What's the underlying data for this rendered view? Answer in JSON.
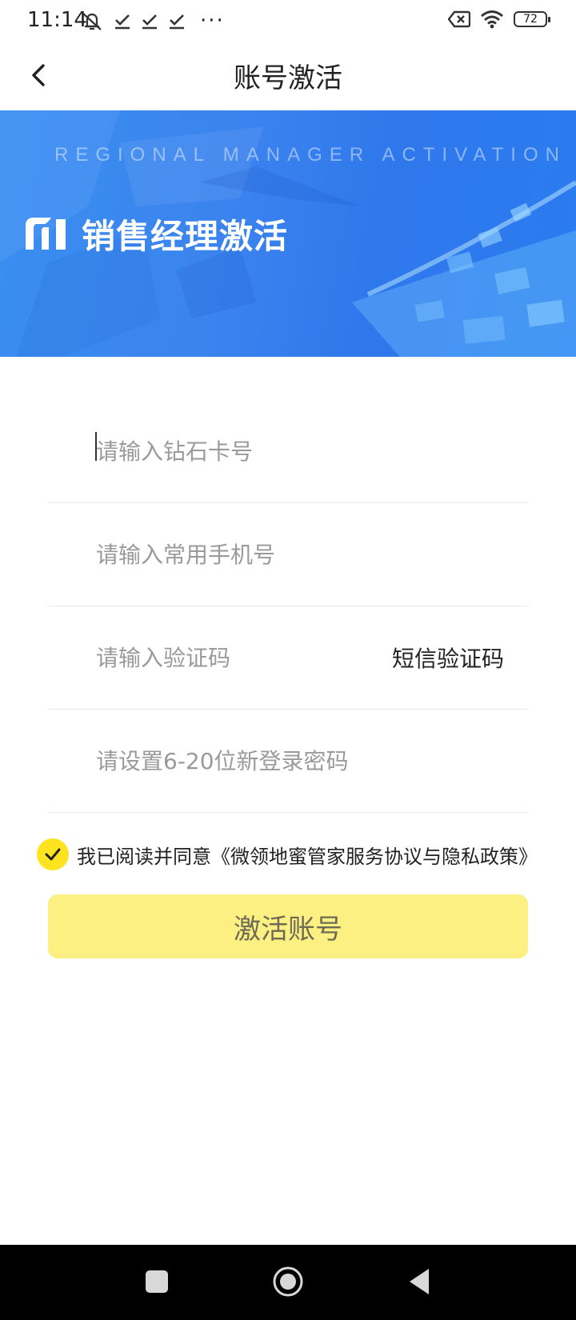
{
  "status_bar": {
    "time": "11:14",
    "left_icons": [
      "mute-notification-icon",
      "check-icon",
      "check-icon",
      "check-icon"
    ],
    "more": "···",
    "battery": "72",
    "right_icons": [
      "no-sim-icon",
      "wifi-icon",
      "battery-icon"
    ]
  },
  "header": {
    "title": "账号激活",
    "back_icon": "back-arrow-icon"
  },
  "banner": {
    "english_title": "REGIONAL MANAGER ACTIVATION",
    "title": "销售经理激活",
    "logo": "brand-logo-icon"
  },
  "form": {
    "card_placeholder": "请输入钻石卡号",
    "phone_placeholder": "请输入常用手机号",
    "code_placeholder": "请输入验证码",
    "sms_button": "短信验证码",
    "password_placeholder": "请设置6-20位新登录密码"
  },
  "agreement": {
    "checked": true,
    "text": "我已阅读并同意《微领地蜜管家服务协议与隐私政策》"
  },
  "activate_button": "激活账号",
  "colors": {
    "accent_yellow": "#fde320",
    "button_bg": "#fdf083",
    "banner_blue": "#2f78ec"
  },
  "nav_bar": [
    "recent-apps-icon",
    "home-icon",
    "back-icon"
  ]
}
